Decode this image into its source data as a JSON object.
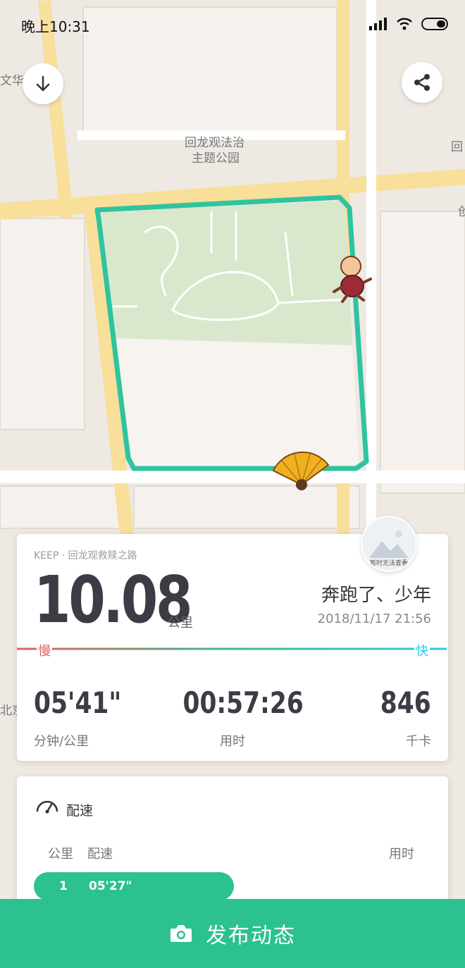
{
  "status_bar": {
    "time": "晚上10:31"
  },
  "map": {
    "labels": {
      "park_line1": "回龙观法治",
      "park_line2": "主题公园",
      "left_edge_1": "文华",
      "left_edge_2": "北京",
      "right_edge_1": "回",
      "right_edge_2": "创"
    },
    "route_color": "#2ec4a0"
  },
  "summary": {
    "source": "KEEP · 回龙观救赎之路",
    "distance": "10.08",
    "distance_unit": "公里",
    "title": "奔跑了、少年",
    "date": "2018/11/17 21:56",
    "avatar_caption": "暂时无法查看",
    "slow_label": "慢",
    "fast_label": "快",
    "pace": {
      "value": "05'41\"",
      "label": "分钟/公里"
    },
    "duration": {
      "value": "00:57:26",
      "label": "用时"
    },
    "calories": {
      "value": "846",
      "label": "千卡"
    }
  },
  "pace_section": {
    "title": "配速",
    "col_km": "公里",
    "col_pace": "配速",
    "col_time": "用时",
    "rows": [
      {
        "km": "1",
        "pace": "05'27\""
      }
    ]
  },
  "bottom": {
    "publish_label": "发布动态"
  },
  "colors": {
    "accent": "#2cc190",
    "slow": "#e06060",
    "fast": "#35c7e0"
  }
}
